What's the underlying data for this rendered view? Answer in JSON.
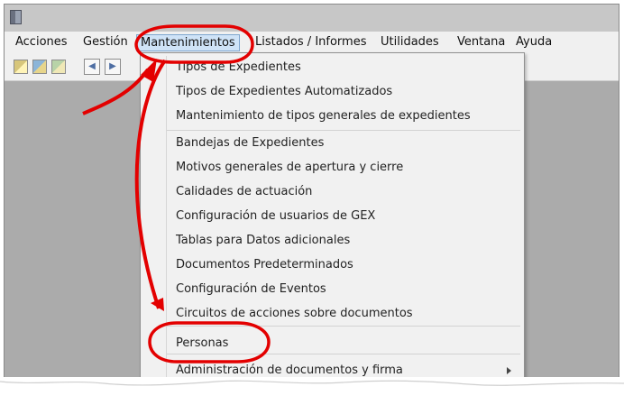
{
  "menubar": {
    "items": [
      "Acciones",
      "Gestión",
      "Mantenimientos",
      "Listados / Informes",
      "Utilidades",
      "Ventana",
      "Ayuda"
    ],
    "active": "Mantenimientos"
  },
  "toolbar": {
    "buttons": [
      "toolbar-icon-1",
      "toolbar-icon-2",
      "toolbar-icon-3",
      "nav-back-icon",
      "nav-forward-icon"
    ]
  },
  "dropdown": {
    "items": [
      "Tipos de Expedientes",
      "Tipos de Expedientes Automatizados",
      "Mantenimiento de tipos generales de expedientes",
      "Bandejas de Expedientes",
      "Motivos generales de apertura y cierre",
      "Calidades de actuación",
      "Configuración de usuarios de GEX",
      "Tablas para Datos adicionales",
      "Documentos Predeterminados",
      "Configuración de Eventos",
      "Circuitos de acciones sobre documentos",
      "Personas",
      "Administración de documentos y firma"
    ],
    "submenu_item": "Administración de documentos y firma",
    "highlighted": "Personas"
  },
  "colors": {
    "annotation_red": "#e30000",
    "menu_active": "#cfe3f7",
    "window_gray": "#ababab",
    "menu_bg": "#f0f0f0"
  }
}
